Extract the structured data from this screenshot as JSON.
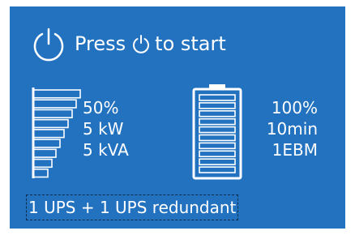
{
  "header": {
    "press_label": "Press",
    "start_label": "to start",
    "power_icon": "power-icon"
  },
  "load": {
    "percent": "50%",
    "power": "5 kW",
    "apparent_power": "5 kVA",
    "gauge_bars": 9,
    "gauge_level": 0.5,
    "gauge_icon": "load-bar-gauge-icon"
  },
  "battery": {
    "charge": "100%",
    "runtime": "10min",
    "modules": "1EBM",
    "level": 1.0,
    "icon": "battery-icon"
  },
  "config": {
    "redundancy_label": "1 UPS + 1 UPS redundant"
  },
  "colors": {
    "background": "#2272c0",
    "foreground": "#ffffff",
    "dashed_border": "#0b2c4a"
  }
}
